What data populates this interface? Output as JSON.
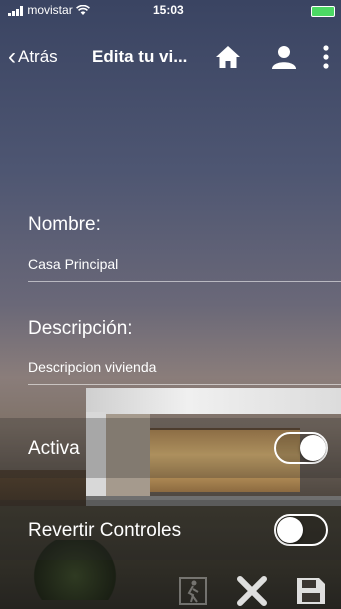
{
  "status_bar": {
    "carrier": "movistar",
    "time": "15:03"
  },
  "nav": {
    "back_label": "Atrás",
    "title": "Edita tu vi..."
  },
  "form": {
    "name_label": "Nombre:",
    "name_value": "Casa Principal",
    "description_label": "Descripción:",
    "description_value": "Descripcion vivienda"
  },
  "toggles": [
    {
      "label": "Activa",
      "on": true
    },
    {
      "label": "Revertir Controles",
      "on": false
    }
  ],
  "colors": {
    "battery": "#4cd964",
    "text": "#ffffff"
  }
}
